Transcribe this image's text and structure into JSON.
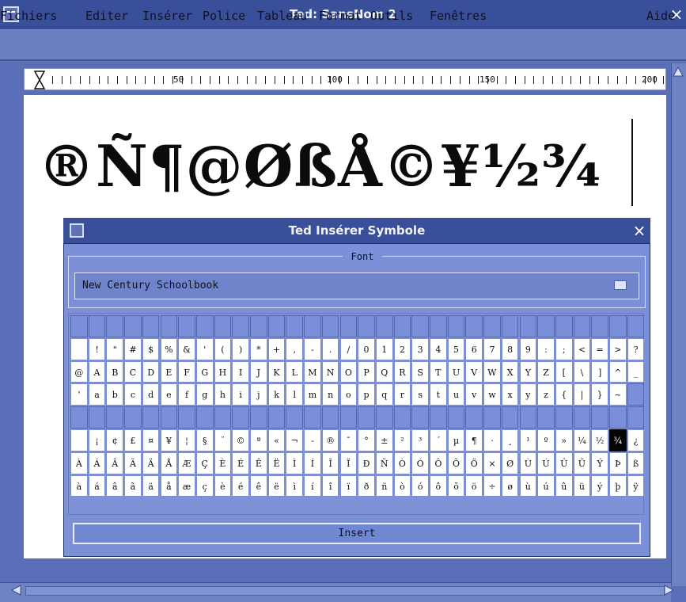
{
  "window": {
    "title": "Ted: SansNom 2",
    "close_glyph": "×",
    "menubar": {
      "items": [
        "Fichiers",
        "Editer",
        "Insérer",
        "Police",
        "Tableau",
        "Format",
        "Outils",
        "Fenêtres"
      ],
      "help": "Aide"
    },
    "ruler": {
      "labels": [
        "50",
        "100",
        "150",
        "200"
      ]
    },
    "document": {
      "text": "®Ñ¶@ØßÅ©¥½¾"
    }
  },
  "dialog": {
    "title": "Ted Insérer Symbole",
    "close_glyph": "×",
    "font_label": "Font",
    "font_value": "New Century Schoolbook",
    "insert_label": "Insert",
    "rows": [
      [
        "",
        "",
        "",
        "",
        "",
        "",
        "",
        "",
        "",
        "",
        "",
        "",
        "",
        "",
        "",
        "",
        "",
        "",
        "",
        "",
        "",
        "",
        "",
        "",
        "",
        "",
        "",
        "",
        "",
        "",
        "",
        ""
      ],
      [
        "",
        "!",
        "\"",
        "#",
        "$",
        "%",
        "&",
        "'",
        "(",
        ")",
        "*",
        "+",
        ",",
        "-",
        ".",
        "/",
        "0",
        "1",
        "2",
        "3",
        "4",
        "5",
        "6",
        "7",
        "8",
        "9",
        ":",
        ";",
        "<",
        "=",
        ">",
        "?"
      ],
      [
        "@",
        "A",
        "B",
        "C",
        "D",
        "E",
        "F",
        "G",
        "H",
        "I",
        "J",
        "K",
        "L",
        "M",
        "N",
        "O",
        "P",
        "Q",
        "R",
        "S",
        "T",
        "U",
        "V",
        "W",
        "X",
        "Y",
        "Z",
        "[",
        "\\",
        "]",
        "^",
        "_"
      ],
      [
        "‘",
        "a",
        "b",
        "c",
        "d",
        "e",
        "f",
        "g",
        "h",
        "i",
        "j",
        "k",
        "l",
        "m",
        "n",
        "o",
        "p",
        "q",
        "r",
        "s",
        "t",
        "u",
        "v",
        "w",
        "x",
        "y",
        "z",
        "{",
        "|",
        "}",
        "~",
        ""
      ],
      [
        "",
        "",
        "",
        "",
        "",
        "",
        "",
        "",
        "",
        "",
        "",
        "",
        "",
        "",
        "",
        "",
        "",
        "",
        "",
        "",
        "",
        "",
        "",
        "",
        "",
        "",
        "",
        "",
        "",
        "",
        "",
        ""
      ],
      [
        "",
        "¡",
        "¢",
        "£",
        "¤",
        "¥",
        "¦",
        "§",
        "¨",
        "©",
        "ª",
        "«",
        "¬",
        "-",
        "®",
        "¯",
        "°",
        "±",
        "²",
        "³",
        "´",
        "µ",
        "¶",
        "·",
        "¸",
        "¹",
        "º",
        "»",
        "¼",
        "½",
        "¾",
        "¿"
      ],
      [
        "À",
        "Á",
        "Â",
        "Ã",
        "Ä",
        "Å",
        "Æ",
        "Ç",
        "È",
        "É",
        "Ê",
        "Ë",
        "Ì",
        "Í",
        "Î",
        "Ï",
        "Ð",
        "Ñ",
        "Ò",
        "Ó",
        "Ô",
        "Õ",
        "Ö",
        "×",
        "Ø",
        "Ù",
        "Ú",
        "Û",
        "Ü",
        "Ý",
        "Þ",
        "ß"
      ],
      [
        "à",
        "á",
        "â",
        "ã",
        "ä",
        "å",
        "æ",
        "ç",
        "è",
        "é",
        "ê",
        "ë",
        "ì",
        "í",
        "î",
        "ï",
        "ð",
        "ñ",
        "ò",
        "ó",
        "ô",
        "õ",
        "ö",
        "÷",
        "ø",
        "ù",
        "ú",
        "û",
        "ü",
        "ý",
        "þ",
        "ÿ"
      ]
    ],
    "selected_char": "¾"
  },
  "colors": {
    "desktop": "#5b6fb8",
    "titlebar": "#3a4f9a",
    "selection": "#050505"
  }
}
